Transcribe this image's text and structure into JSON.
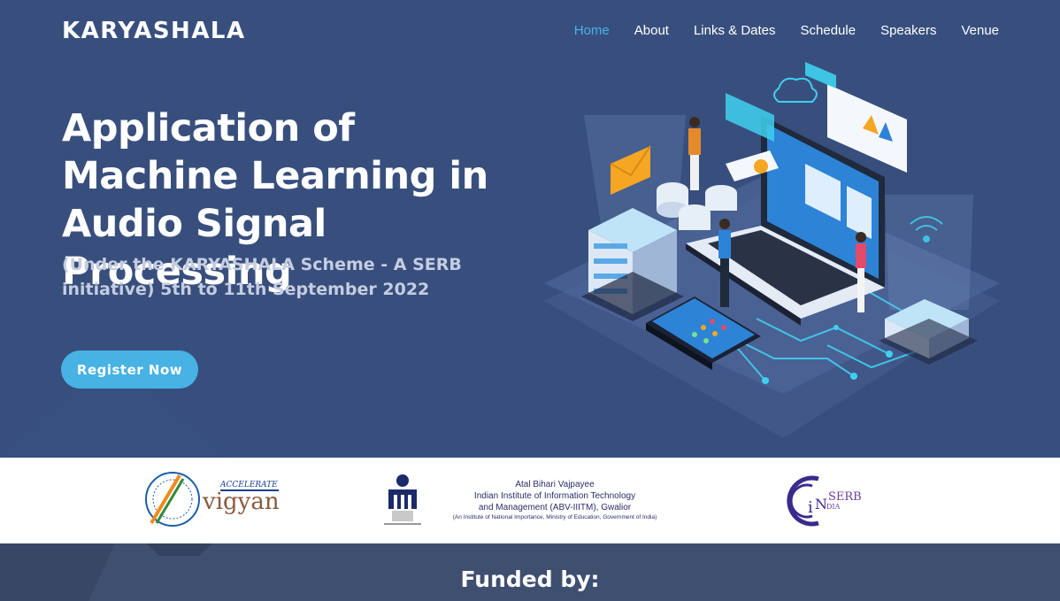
{
  "header": {
    "brand": "KARYASHALA",
    "nav": [
      "Home",
      "About",
      "Links & Dates",
      "Schedule",
      "Speakers",
      "Venue"
    ],
    "active_nav": "Home"
  },
  "hero": {
    "title": "Application of Machine Learning in Audio Signal Processing",
    "subtitle": "(Under the KARYASHALA Scheme - A SERB initiative) 5th to 11th September 2022",
    "cta_label": "Register Now",
    "illustration": "isometric-laptop-servers-network-illustration"
  },
  "partners": {
    "accelerate_vigyan": {
      "tagline": "ACCELERATE",
      "name": "vigyan"
    },
    "iiitm": {
      "line1": "Atal Bihari Vajpayee",
      "line2": "Indian Institute of Information Technology",
      "line3": "and Management (ABV-IIITM), Gwalior",
      "line4": "(An Institute of National Importance, Ministry of Education, Government of India)"
    },
    "serb": {
      "name": "SERB",
      "country": "INDIA"
    }
  },
  "funded": {
    "heading": "Funded by:"
  },
  "colors": {
    "hero_bg": "#384f7e",
    "accent": "#47b2e4",
    "funded_bg": "#3f4f70",
    "logos_bg": "#ffffff"
  }
}
